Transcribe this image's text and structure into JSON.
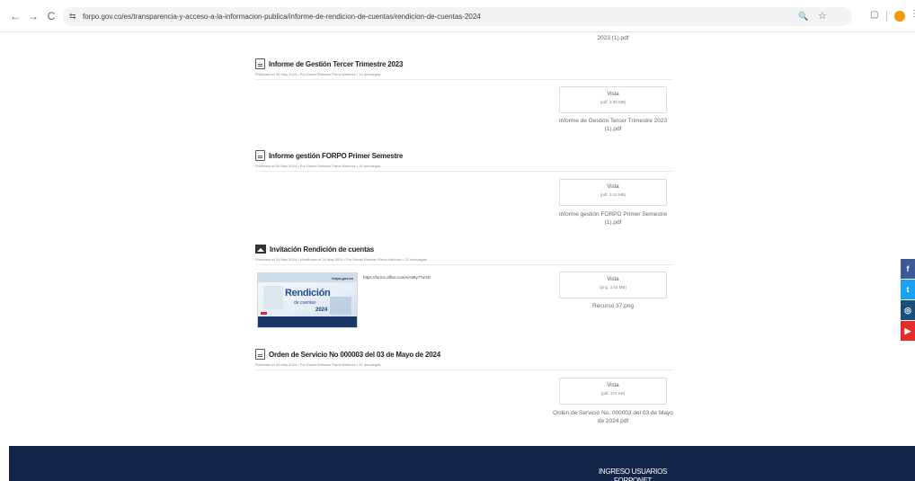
{
  "browser": {
    "back_glyph": "←",
    "forward_glyph": "→",
    "reload_glyph": "C",
    "site_info_glyph": "⇆",
    "url": "forpo.gov.co/es/transparencia-y-acceso-a-la-informacion-publica/informe-de-rendicion-de-cuentas/rendicion-de-cuentas-2024",
    "zoom_glyph": "🔍",
    "bookmark_glyph": "☆",
    "extensions_glyph": "▢",
    "menu_glyph": "⋮",
    "icons": [
      "back-icon",
      "forward-icon",
      "reload-icon",
      "site-info-icon",
      "zoom-icon",
      "star-icon",
      "extensions-icon",
      "profile-avatar",
      "menu-icon"
    ],
    "profile_color": "#f29900"
  },
  "page": {
    "top_file_name": "2023 (1).pdf",
    "documents": [
      {
        "title": "Informe de Gestión Tercer Trimestre 2023",
        "meta": "Publicado el 06 May 2024 • Por Daniel Esteban Parra Martínez • 34 descargas",
        "icon": "pdf-document-icon",
        "card": {
          "label": "Vista",
          "size": "(pdf, 3.50 MB)"
        },
        "file_name": "Informe de Gestión Tercer Trimestre 2023 (1).pdf"
      },
      {
        "title": "Informe gestión FORPO Primer Semestre",
        "meta": "Publicado el 06 May 2024 • Por Daniel Esteban Parra Martínez • 34 descargas",
        "icon": "pdf-document-icon",
        "card": {
          "label": "Vista",
          "size": "(pdf, 3.16 MB)"
        },
        "file_name": "Informe gestión FORPO Primer Semestre (1).pdf"
      },
      {
        "title": "Invitación Rendición de cuentas",
        "meta": "Publicado el 24 May 2024 • Modificado el 24 May 2024 • Por Daniel Esteban Parra Martínez • 22 descargas",
        "icon": "image-icon",
        "link": "https://forms.office.com/r/A88y7TuGD",
        "thumbnail": {
          "brand": "forpo.gov.co",
          "title": "Rendición",
          "subtitle": "de cuentas",
          "year": "2024"
        },
        "card": {
          "label": "Vista",
          "size": "(png, 3.64 MB)"
        },
        "file_name": "Recurso 37.png"
      },
      {
        "title": "Orden de Servicio No 000003 del 03 de Mayo de 2024",
        "meta": "Publicado el 06 May 2024 • Por Daniel Esteban Parra Martínez • 37 descargas",
        "icon": "pdf-document-icon",
        "card": {
          "label": "Vista",
          "size": "(pdf, 374 KB)"
        },
        "file_name": "Orden de Servicio No. 000003 del 03 de Mayo de 2024.pdf"
      }
    ]
  },
  "footer": {
    "title": "INGRESO USUARIOS FORPONET",
    "background": "#14254a"
  },
  "social": [
    {
      "name": "facebook",
      "glyph": "f",
      "color": "#3b5998",
      "icon": "facebook-icon"
    },
    {
      "name": "twitter",
      "glyph": "t",
      "color": "#1da1f2",
      "icon": "twitter-icon"
    },
    {
      "name": "instagram",
      "glyph": "◎",
      "color": "#1a4f7a",
      "icon": "instagram-icon"
    },
    {
      "name": "youtube",
      "glyph": "▶",
      "color": "#e52d27",
      "icon": "youtube-icon"
    }
  ]
}
